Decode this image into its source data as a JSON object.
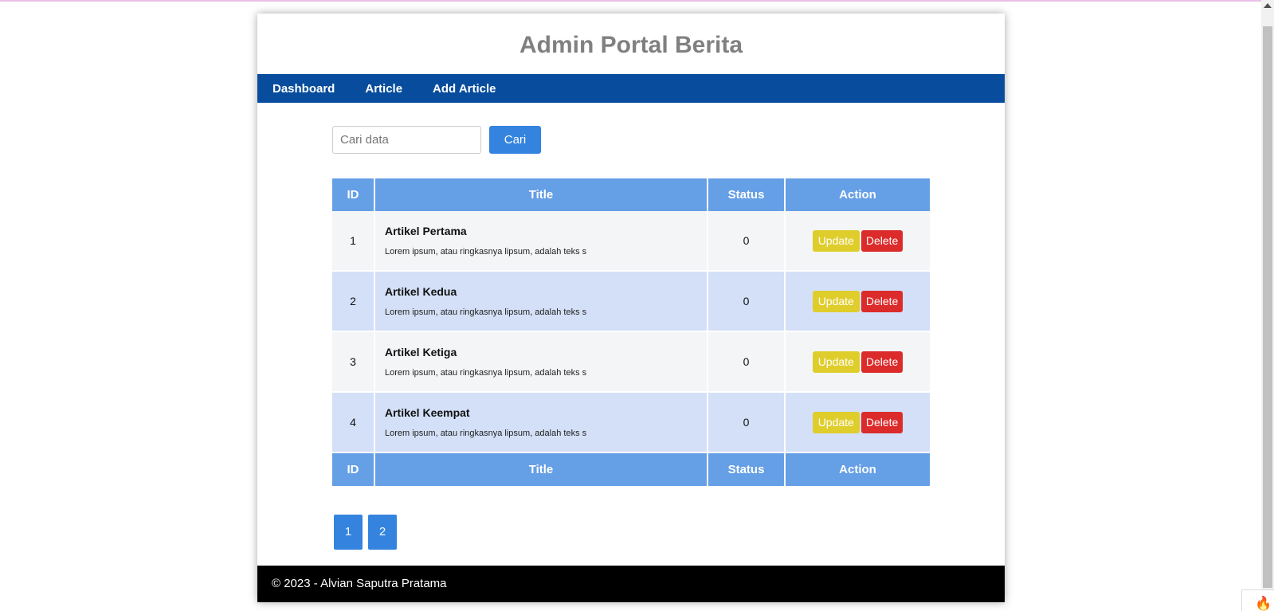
{
  "header": {
    "title": "Admin Portal Berita"
  },
  "nav": {
    "items": [
      "Dashboard",
      "Article",
      "Add Article"
    ]
  },
  "search": {
    "placeholder": "Cari data",
    "button_label": "Cari"
  },
  "table": {
    "columns": [
      "ID",
      "Title",
      "Status",
      "Action"
    ],
    "rows": [
      {
        "id": "1",
        "title": "Artikel Pertama",
        "excerpt": "Lorem ipsum, atau ringkasnya lipsum, adalah teks s",
        "status": "0",
        "update_label": "Update",
        "delete_label": "Delete"
      },
      {
        "id": "2",
        "title": "Artikel Kedua",
        "excerpt": "Lorem ipsum, atau ringkasnya lipsum, adalah teks s",
        "status": "0",
        "update_label": "Update",
        "delete_label": "Delete"
      },
      {
        "id": "3",
        "title": "Artikel Ketiga",
        "excerpt": "Lorem ipsum, atau ringkasnya lipsum, adalah teks s",
        "status": "0",
        "update_label": "Update",
        "delete_label": "Delete"
      },
      {
        "id": "4",
        "title": "Artikel Keempat",
        "excerpt": "Lorem ipsum, atau ringkasnya lipsum, adalah teks s",
        "status": "0",
        "update_label": "Update",
        "delete_label": "Delete"
      }
    ],
    "footer_columns": [
      "ID",
      "Title",
      "Status",
      "Action"
    ]
  },
  "pagination": {
    "pages": [
      "1",
      "2"
    ]
  },
  "footer": {
    "text": "© 2023 - Alvian Saputra Pratama"
  },
  "colors": {
    "nav_bg": "#084d9d",
    "table_header_bg": "#659fe5",
    "primary_button": "#3484df",
    "update_button": "#dfcd2c",
    "delete_button": "#dc2b2b",
    "footer_bg": "#000000"
  },
  "icons": {
    "corner_widget": "flame-icon"
  }
}
